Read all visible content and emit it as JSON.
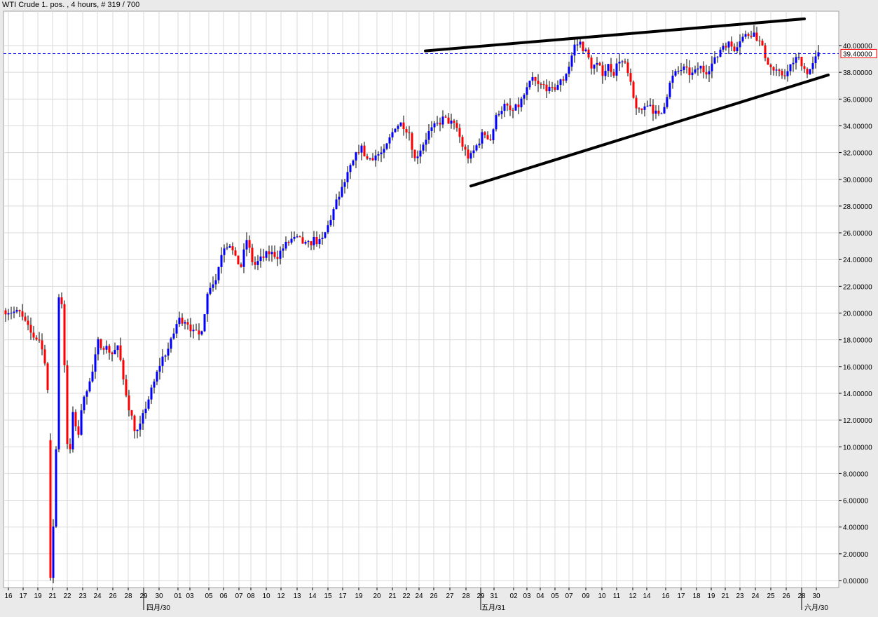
{
  "header": {
    "title": "WTI Crude 1. pos. , 4 hours, # 319 / 700"
  },
  "current_price_label": "39.40000",
  "colors": {
    "up": "#0000ff",
    "down": "#ff0000",
    "grid": "#d9d9d9",
    "plot_bg": "#ffffff",
    "frame_bg": "#eaeaea",
    "price_line": "#0000ff",
    "trendline": "#000000"
  },
  "chart_data": {
    "type": "candlestick",
    "title": "WTI Crude 1. pos. , 4 hours, # 319 / 700",
    "ylim": [
      0,
      42
    ],
    "y_ticks": [
      "0.00000",
      "2.00000",
      "4.00000",
      "6.00000",
      "8.00000",
      "10.00000",
      "12.00000",
      "14.00000",
      "16.00000",
      "18.00000",
      "20.00000",
      "22.00000",
      "24.00000",
      "26.00000",
      "28.00000",
      "30.00000",
      "32.00000",
      "34.00000",
      "36.00000",
      "38.00000",
      "40.00000"
    ],
    "x_tick_labels": [
      "16",
      "17",
      "19",
      "21",
      "22",
      "23",
      "24",
      "26",
      "28",
      "29",
      "30",
      "01",
      "03",
      "05",
      "06",
      "07",
      "08",
      "10",
      "12",
      "13",
      "14",
      "15",
      "17",
      "19",
      "20",
      "21",
      "22",
      "24",
      "26",
      "27",
      "28",
      "29",
      "31",
      "02",
      "03",
      "04",
      "05",
      "07",
      "09",
      "10",
      "11",
      "12",
      "14",
      "16",
      "17",
      "18",
      "19",
      "21",
      "23",
      "24",
      "25",
      "26",
      "28",
      "30"
    ],
    "period_labels": [
      "四月/30",
      "五月/31",
      "六月/30"
    ],
    "current_price": 39.4,
    "trendlines": [
      {
        "name": "upper",
        "from": [
          "24",
          39.6
        ],
        "to": [
          "30",
          42.0
        ]
      },
      {
        "name": "lower",
        "from": [
          "28",
          29.5
        ],
        "to": [
          "30",
          37.8
        ]
      }
    ],
    "price_anchors": [
      [
        0,
        20.2
      ],
      [
        20,
        20.0
      ],
      [
        38,
        18.3
      ],
      [
        48,
        18.0
      ],
      [
        56,
        16.5
      ],
      [
        64,
        12.0
      ],
      [
        70,
        0.2
      ],
      [
        72,
        9.8
      ],
      [
        76,
        21.3
      ],
      [
        82,
        20.5
      ],
      [
        86,
        12.0
      ],
      [
        90,
        8.0
      ],
      [
        95,
        12.5
      ],
      [
        104,
        11.0
      ],
      [
        112,
        14.0
      ],
      [
        122,
        15.0
      ],
      [
        132,
        17.8
      ],
      [
        142,
        17.5
      ],
      [
        152,
        17.0
      ],
      [
        160,
        17.5
      ],
      [
        168,
        15.0
      ],
      [
        176,
        13.0
      ],
      [
        186,
        11.0
      ],
      [
        192,
        11.5
      ],
      [
        200,
        13.0
      ],
      [
        212,
        14.8
      ],
      [
        222,
        16.5
      ],
      [
        234,
        17.5
      ],
      [
        246,
        19.5
      ],
      [
        258,
        19.5
      ],
      [
        268,
        18.5
      ],
      [
        278,
        18.3
      ],
      [
        290,
        22.0
      ],
      [
        300,
        22.5
      ],
      [
        310,
        25.0
      ],
      [
        320,
        25.2
      ],
      [
        328,
        24.0
      ],
      [
        336,
        23.5
      ],
      [
        344,
        25.5
      ],
      [
        354,
        23.5
      ],
      [
        364,
        24.0
      ],
      [
        376,
        24.5
      ],
      [
        388,
        24.3
      ],
      [
        398,
        25.0
      ],
      [
        408,
        25.5
      ],
      [
        418,
        25.5
      ],
      [
        430,
        25.0
      ],
      [
        440,
        25.5
      ],
      [
        450,
        25.2
      ],
      [
        460,
        26.5
      ],
      [
        470,
        28.0
      ],
      [
        482,
        29.5
      ],
      [
        490,
        30.6
      ],
      [
        498,
        31.5
      ],
      [
        506,
        32.5
      ],
      [
        516,
        31.5
      ],
      [
        528,
        31.8
      ],
      [
        540,
        32.0
      ],
      [
        548,
        33.0
      ],
      [
        556,
        34.0
      ],
      [
        566,
        34.2
      ],
      [
        576,
        33.5
      ],
      [
        584,
        31.5
      ],
      [
        594,
        32.5
      ],
      [
        604,
        33.5
      ],
      [
        614,
        34.0
      ],
      [
        624,
        34.5
      ],
      [
        634,
        34.3
      ],
      [
        644,
        33.8
      ],
      [
        652,
        32.5
      ],
      [
        662,
        31.5
      ],
      [
        672,
        32.5
      ],
      [
        682,
        33.5
      ],
      [
        692,
        33.0
      ],
      [
        702,
        35.0
      ],
      [
        712,
        35.5
      ],
      [
        722,
        35.0
      ],
      [
        732,
        35.5
      ],
      [
        742,
        36.5
      ],
      [
        752,
        37.5
      ],
      [
        760,
        37.0
      ],
      [
        770,
        37.0
      ],
      [
        778,
        36.5
      ],
      [
        786,
        37.0
      ],
      [
        796,
        37.5
      ],
      [
        804,
        38.5
      ],
      [
        812,
        40.0
      ],
      [
        820,
        40.2
      ],
      [
        828,
        39.5
      ],
      [
        836,
        38.5
      ],
      [
        844,
        38.5
      ],
      [
        852,
        38.0
      ],
      [
        860,
        38.5
      ],
      [
        868,
        38.0
      ],
      [
        876,
        39.0
      ],
      [
        884,
        38.5
      ],
      [
        890,
        37.5
      ],
      [
        896,
        36.0
      ],
      [
        904,
        35.0
      ],
      [
        910,
        35.3
      ],
      [
        918,
        35.8
      ],
      [
        926,
        35.0
      ],
      [
        934,
        34.6
      ],
      [
        942,
        36.0
      ],
      [
        950,
        37.5
      ],
      [
        958,
        38.0
      ],
      [
        966,
        38.3
      ],
      [
        974,
        38.0
      ],
      [
        982,
        37.8
      ],
      [
        990,
        38.5
      ],
      [
        998,
        38.0
      ],
      [
        1006,
        38.5
      ],
      [
        1014,
        39.0
      ],
      [
        1022,
        40.0
      ],
      [
        1030,
        40.2
      ],
      [
        1040,
        39.8
      ],
      [
        1048,
        40.5
      ],
      [
        1058,
        40.8
      ],
      [
        1066,
        41.0
      ],
      [
        1074,
        40.5
      ],
      [
        1082,
        39.5
      ],
      [
        1090,
        38.5
      ],
      [
        1098,
        38.0
      ],
      [
        1106,
        37.8
      ],
      [
        1116,
        38.0
      ],
      [
        1126,
        39.0
      ],
      [
        1134,
        39.0
      ],
      [
        1142,
        38.0
      ],
      [
        1150,
        38.3
      ],
      [
        1158,
        39.2
      ],
      [
        1166,
        39.6
      ],
      [
        1170,
        39.4
      ]
    ]
  }
}
